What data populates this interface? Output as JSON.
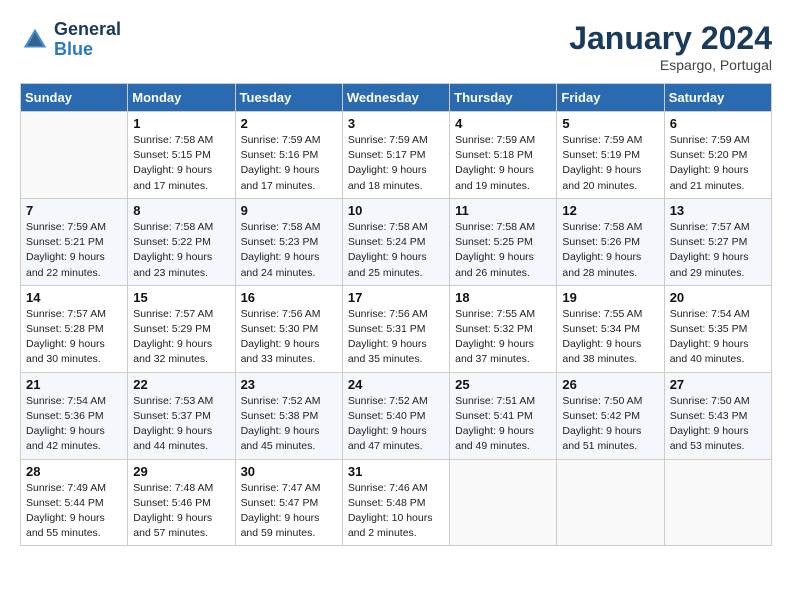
{
  "header": {
    "logo_line1": "General",
    "logo_line2": "Blue",
    "month": "January 2024",
    "location": "Espargo, Portugal"
  },
  "days_of_week": [
    "Sunday",
    "Monday",
    "Tuesday",
    "Wednesday",
    "Thursday",
    "Friday",
    "Saturday"
  ],
  "weeks": [
    [
      {
        "day": "",
        "info": ""
      },
      {
        "day": "1",
        "info": "Sunrise: 7:58 AM\nSunset: 5:15 PM\nDaylight: 9 hours\nand 17 minutes."
      },
      {
        "day": "2",
        "info": "Sunrise: 7:59 AM\nSunset: 5:16 PM\nDaylight: 9 hours\nand 17 minutes."
      },
      {
        "day": "3",
        "info": "Sunrise: 7:59 AM\nSunset: 5:17 PM\nDaylight: 9 hours\nand 18 minutes."
      },
      {
        "day": "4",
        "info": "Sunrise: 7:59 AM\nSunset: 5:18 PM\nDaylight: 9 hours\nand 19 minutes."
      },
      {
        "day": "5",
        "info": "Sunrise: 7:59 AM\nSunset: 5:19 PM\nDaylight: 9 hours\nand 20 minutes."
      },
      {
        "day": "6",
        "info": "Sunrise: 7:59 AM\nSunset: 5:20 PM\nDaylight: 9 hours\nand 21 minutes."
      }
    ],
    [
      {
        "day": "7",
        "info": "Sunrise: 7:59 AM\nSunset: 5:21 PM\nDaylight: 9 hours\nand 22 minutes."
      },
      {
        "day": "8",
        "info": "Sunrise: 7:58 AM\nSunset: 5:22 PM\nDaylight: 9 hours\nand 23 minutes."
      },
      {
        "day": "9",
        "info": "Sunrise: 7:58 AM\nSunset: 5:23 PM\nDaylight: 9 hours\nand 24 minutes."
      },
      {
        "day": "10",
        "info": "Sunrise: 7:58 AM\nSunset: 5:24 PM\nDaylight: 9 hours\nand 25 minutes."
      },
      {
        "day": "11",
        "info": "Sunrise: 7:58 AM\nSunset: 5:25 PM\nDaylight: 9 hours\nand 26 minutes."
      },
      {
        "day": "12",
        "info": "Sunrise: 7:58 AM\nSunset: 5:26 PM\nDaylight: 9 hours\nand 28 minutes."
      },
      {
        "day": "13",
        "info": "Sunrise: 7:57 AM\nSunset: 5:27 PM\nDaylight: 9 hours\nand 29 minutes."
      }
    ],
    [
      {
        "day": "14",
        "info": "Sunrise: 7:57 AM\nSunset: 5:28 PM\nDaylight: 9 hours\nand 30 minutes."
      },
      {
        "day": "15",
        "info": "Sunrise: 7:57 AM\nSunset: 5:29 PM\nDaylight: 9 hours\nand 32 minutes."
      },
      {
        "day": "16",
        "info": "Sunrise: 7:56 AM\nSunset: 5:30 PM\nDaylight: 9 hours\nand 33 minutes."
      },
      {
        "day": "17",
        "info": "Sunrise: 7:56 AM\nSunset: 5:31 PM\nDaylight: 9 hours\nand 35 minutes."
      },
      {
        "day": "18",
        "info": "Sunrise: 7:55 AM\nSunset: 5:32 PM\nDaylight: 9 hours\nand 37 minutes."
      },
      {
        "day": "19",
        "info": "Sunrise: 7:55 AM\nSunset: 5:34 PM\nDaylight: 9 hours\nand 38 minutes."
      },
      {
        "day": "20",
        "info": "Sunrise: 7:54 AM\nSunset: 5:35 PM\nDaylight: 9 hours\nand 40 minutes."
      }
    ],
    [
      {
        "day": "21",
        "info": "Sunrise: 7:54 AM\nSunset: 5:36 PM\nDaylight: 9 hours\nand 42 minutes."
      },
      {
        "day": "22",
        "info": "Sunrise: 7:53 AM\nSunset: 5:37 PM\nDaylight: 9 hours\nand 44 minutes."
      },
      {
        "day": "23",
        "info": "Sunrise: 7:52 AM\nSunset: 5:38 PM\nDaylight: 9 hours\nand 45 minutes."
      },
      {
        "day": "24",
        "info": "Sunrise: 7:52 AM\nSunset: 5:40 PM\nDaylight: 9 hours\nand 47 minutes."
      },
      {
        "day": "25",
        "info": "Sunrise: 7:51 AM\nSunset: 5:41 PM\nDaylight: 9 hours\nand 49 minutes."
      },
      {
        "day": "26",
        "info": "Sunrise: 7:50 AM\nSunset: 5:42 PM\nDaylight: 9 hours\nand 51 minutes."
      },
      {
        "day": "27",
        "info": "Sunrise: 7:50 AM\nSunset: 5:43 PM\nDaylight: 9 hours\nand 53 minutes."
      }
    ],
    [
      {
        "day": "28",
        "info": "Sunrise: 7:49 AM\nSunset: 5:44 PM\nDaylight: 9 hours\nand 55 minutes."
      },
      {
        "day": "29",
        "info": "Sunrise: 7:48 AM\nSunset: 5:46 PM\nDaylight: 9 hours\nand 57 minutes."
      },
      {
        "day": "30",
        "info": "Sunrise: 7:47 AM\nSunset: 5:47 PM\nDaylight: 9 hours\nand 59 minutes."
      },
      {
        "day": "31",
        "info": "Sunrise: 7:46 AM\nSunset: 5:48 PM\nDaylight: 10 hours\nand 2 minutes."
      },
      {
        "day": "",
        "info": ""
      },
      {
        "day": "",
        "info": ""
      },
      {
        "day": "",
        "info": ""
      }
    ]
  ]
}
